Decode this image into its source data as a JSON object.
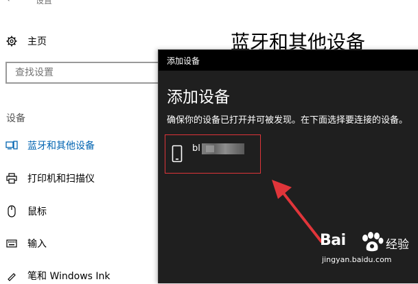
{
  "settings": {
    "window_title": "设置",
    "home_label": "主页",
    "search_placeholder": "查找设置",
    "section_label": "设备",
    "nav_items": [
      {
        "label": "蓝牙和其他设备",
        "icon": "bluetooth-devices-icon",
        "active": true
      },
      {
        "label": "打印机和扫描仪",
        "icon": "printer-icon",
        "active": false
      },
      {
        "label": "鼠标",
        "icon": "mouse-icon",
        "active": false
      },
      {
        "label": "输入",
        "icon": "keyboard-icon",
        "active": false
      },
      {
        "label": "笔和 Windows Ink",
        "icon": "pen-icon",
        "active": false
      }
    ],
    "main_title": "蓝牙和其他设备"
  },
  "dialog": {
    "titlebar": "添加设备",
    "heading": "添加设备",
    "description": "确保你的设备已打开并可被发现。在下面选择要连接的设备。",
    "device_name": "bl",
    "device_icon": "phone-icon"
  },
  "watermark": {
    "brand": "Bai",
    "brand_cn": "经验",
    "url": "jingyan.baidu.com"
  },
  "colors": {
    "accent": "#0063b1",
    "dialog_bg": "#1f1f1f",
    "highlight_red": "#e0353a"
  }
}
